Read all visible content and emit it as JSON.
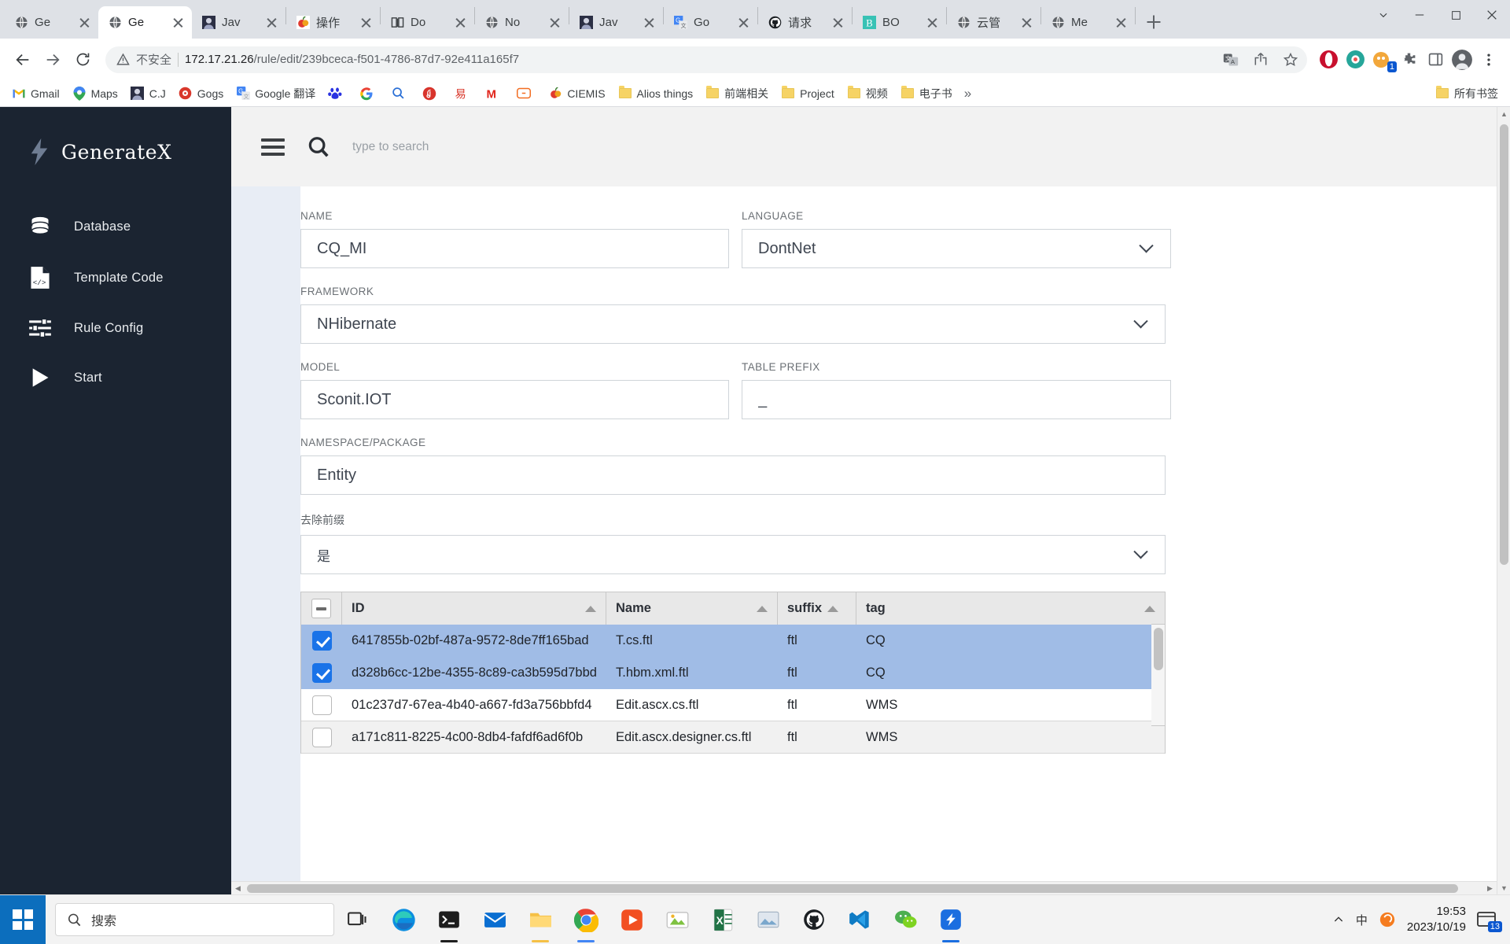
{
  "browser": {
    "tabs": [
      {
        "title": "Ge",
        "icon": "globe-icon",
        "active": false
      },
      {
        "title": "Ge",
        "icon": "globe-icon",
        "active": true
      },
      {
        "title": "Jav",
        "icon": "avatar-icon",
        "active": false
      },
      {
        "title": "操作",
        "icon": "apple-icon",
        "active": false
      },
      {
        "title": "Do",
        "icon": "book-icon",
        "active": false
      },
      {
        "title": "No",
        "icon": "globe-icon",
        "active": false
      },
      {
        "title": "Jav",
        "icon": "avatar-icon",
        "active": false
      },
      {
        "title": "Go",
        "icon": "google-translate-icon",
        "active": false
      },
      {
        "title": "请求",
        "icon": "github-icon",
        "active": false
      },
      {
        "title": "BO",
        "icon": "b-icon",
        "active": false
      },
      {
        "title": "云管",
        "icon": "globe-icon",
        "active": false
      },
      {
        "title": "Me",
        "icon": "globe-icon",
        "active": false
      }
    ],
    "new_tab_label": "+",
    "window_controls": [
      "chevron-down-icon",
      "minimize-icon",
      "maximize-icon",
      "close-icon"
    ],
    "nav": {
      "back": "back-arrow-icon",
      "forward": "forward-arrow-icon",
      "reload": "reload-icon"
    },
    "omnibox": {
      "security_label": "不安全",
      "url_host": "172.17.21.26",
      "url_path": "/rule/edit/239bceca-f501-4786-87d7-92e411a165f7",
      "url_full": "172.17.21.26/rule/edit/239bceca-f501-4786-87d7-92e411a165f7"
    },
    "toolbar_icons": [
      "translate-icon",
      "share-icon",
      "bookmark-star-icon",
      "opera-icon",
      "extension-circle-icon",
      "badge-icon",
      "puzzle-icon",
      "sidepanel-icon",
      "profile-avatar-icon",
      "more-menu-icon"
    ],
    "badge_count": "1",
    "bookmarks": [
      {
        "label": "Gmail",
        "icon": "gmail-icon"
      },
      {
        "label": "Maps",
        "icon": "maps-icon"
      },
      {
        "label": "C.J",
        "icon": "avatar-icon"
      },
      {
        "label": "Gogs",
        "icon": "gogs-icon"
      },
      {
        "label": "Google 翻译",
        "icon": "google-translate-icon"
      },
      {
        "label": "",
        "icon": "baidu-icon"
      },
      {
        "label": "",
        "icon": "google-g-icon"
      },
      {
        "label": "",
        "icon": "search-blue-icon"
      },
      {
        "label": "",
        "icon": "netease-music-icon"
      },
      {
        "label": "",
        "icon": "red-stamp-icon"
      },
      {
        "label": "",
        "icon": "m-red-icon"
      },
      {
        "label": "",
        "icon": "bracket-orange-icon"
      },
      {
        "label": "CIEMIS",
        "icon": "apple-icon"
      },
      {
        "label": "Alios things",
        "icon": "folder-icon"
      },
      {
        "label": "前端相关",
        "icon": "folder-icon"
      },
      {
        "label": "Project",
        "icon": "folder-icon"
      },
      {
        "label": "视频",
        "icon": "folder-icon"
      },
      {
        "label": "电子书",
        "icon": "folder-icon"
      }
    ],
    "bookmarks_overflow": "»",
    "all_bookmarks_label": "所有书签",
    "all_bookmarks_icon": "folder-icon"
  },
  "app": {
    "brand": "GenerateX",
    "brand_icon": "lightning-bolt-icon",
    "sidebar": [
      {
        "label": "Database",
        "icon": "database-icon"
      },
      {
        "label": "Template Code",
        "icon": "code-file-icon"
      },
      {
        "label": "Rule Config",
        "icon": "sliders-icon"
      },
      {
        "label": "Start",
        "icon": "play-icon"
      }
    ],
    "topbar": {
      "menu_icon": "hamburger-icon",
      "search_icon": "search-icon",
      "search_placeholder": "type to search",
      "search_value": ""
    },
    "form": {
      "name": {
        "label": "NAME",
        "value": "CQ_MI"
      },
      "language": {
        "label": "LANGUAGE",
        "value": "DontNet"
      },
      "framework": {
        "label": "FRAMEWORK",
        "value": "NHibernate"
      },
      "model": {
        "label": "MODEL",
        "value": "Sconit.IOT"
      },
      "table_prefix": {
        "label": "TABLE PREFIX",
        "value": "_"
      },
      "namespace": {
        "label": "NAMESPACE/PACKAGE",
        "value": "Entity"
      },
      "remove_prefix": {
        "label": "去除前缀",
        "value": "是"
      }
    },
    "grid": {
      "select_all_state": "indeterminate",
      "columns": [
        {
          "key": "id",
          "label": "ID",
          "sort": "asc"
        },
        {
          "key": "name",
          "label": "Name",
          "sort": "asc"
        },
        {
          "key": "suffix",
          "label": "suffix",
          "sort": "asc"
        },
        {
          "key": "tag",
          "label": "tag",
          "sort": "asc"
        }
      ],
      "rows": [
        {
          "checked": true,
          "id": "6417855b-02bf-487a-9572-8de7ff165bad",
          "name": "T.cs.ftl",
          "suffix": "ftl",
          "tag": "CQ"
        },
        {
          "checked": true,
          "id": "d328b6cc-12be-4355-8c89-ca3b595d7bbd",
          "name": "T.hbm.xml.ftl",
          "suffix": "ftl",
          "tag": "CQ"
        },
        {
          "checked": false,
          "id": "01c237d7-67ea-4b40-a667-fd3a756bbfd4",
          "name": "Edit.ascx.cs.ftl",
          "suffix": "ftl",
          "tag": "WMS"
        },
        {
          "checked": false,
          "id": "a171c811-8225-4c00-8db4-fafdf6ad6f0b",
          "name": "Edit.ascx.designer.cs.ftl",
          "suffix": "ftl",
          "tag": "WMS"
        }
      ]
    }
  },
  "taskbar": {
    "start_icon": "windows-logo-icon",
    "search_placeholder": "搜索",
    "search_icon": "search-icon",
    "apps": [
      {
        "name": "task-view-icon"
      },
      {
        "name": "edge-icon"
      },
      {
        "name": "terminal-icon"
      },
      {
        "name": "mail-icon"
      },
      {
        "name": "file-explorer-icon"
      },
      {
        "name": "chrome-icon"
      },
      {
        "name": "media-player-icon"
      },
      {
        "name": "snip-tool-icon"
      },
      {
        "name": "excel-icon"
      },
      {
        "name": "photos-icon"
      },
      {
        "name": "git-icon"
      },
      {
        "name": "vscode-icon"
      },
      {
        "name": "wechat-icon"
      },
      {
        "name": "dingtalk-icon"
      }
    ],
    "tray": {
      "chevron_icon": "chevron-up-icon",
      "ime_label": "中",
      "sogou_icon": "sogou-icon",
      "time": "19:53",
      "date": "2023/10/19",
      "notification_icon": "notification-icon",
      "notification_count": "13"
    }
  }
}
